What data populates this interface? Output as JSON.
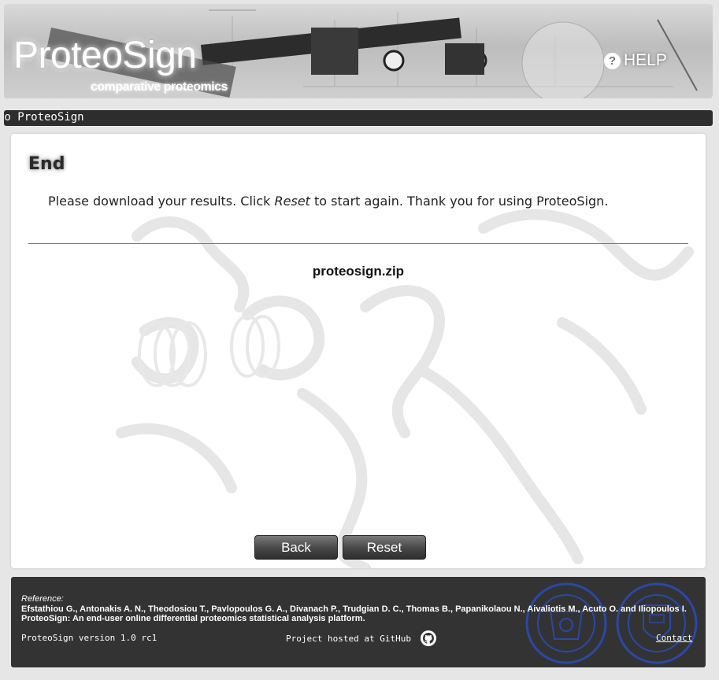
{
  "header": {
    "brand": "ProteoSign",
    "tagline": "comparative proteomics",
    "help_label": "HELP"
  },
  "ticker": {
    "text": "to ProteoSign"
  },
  "main": {
    "step_title": "End",
    "message_before": "Please download your results. Click ",
    "message_emphasis": "Reset",
    "message_after": " to start again. Thank you for using ProteoSign.",
    "result_file": "proteosign.zip",
    "back_label": "Back",
    "reset_label": "Reset"
  },
  "footer": {
    "reference_label": "Reference:",
    "reference_authors": "Efstathiou G., Antonakis A. N., Theodosiou T., Pavlopoulos G. A., Divanach P., Trudgian D. C., Thomas B., Papanikolaou N., Aivaliotis M., Acuto O. and Iliopoulos I.",
    "reference_title": "ProteoSign: An end-user online differential proteomics statistical analysis platform.",
    "version": "ProteoSign version 1.0 rc1",
    "github_text": "Project hosted at GitHub",
    "contact_label": "Contact"
  },
  "icons": {
    "help": "question-circle-icon",
    "github": "github-icon"
  },
  "colors": {
    "ticker_bg": "#2d2d2d",
    "footer_bg": "#333333",
    "button_dark": "#2e2e2e",
    "seal_blue": "#2a48a8"
  }
}
